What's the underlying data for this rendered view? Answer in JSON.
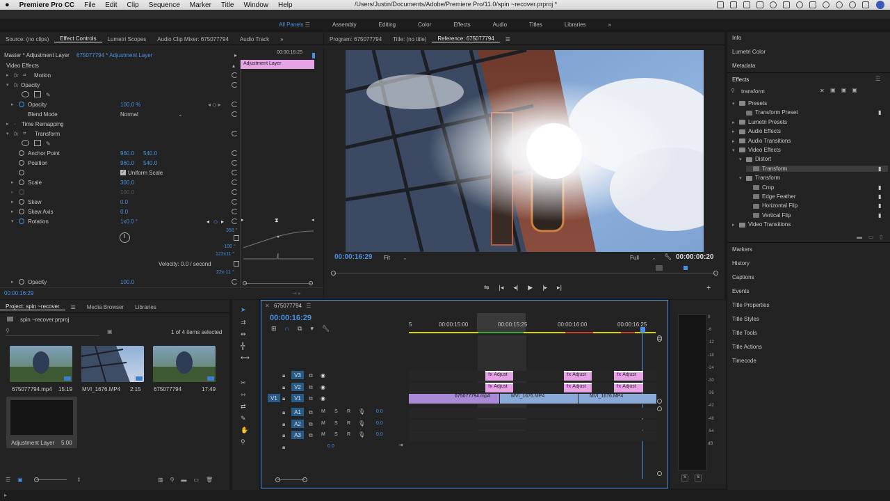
{
  "menubar": {
    "apple": "",
    "app": "Premiere Pro CC",
    "items": [
      "File",
      "Edit",
      "Clip",
      "Sequence",
      "Marker",
      "Title",
      "Window",
      "Help"
    ],
    "path": "/Users/Justin/Documents/Adobe/Premiere Pro/11.0/spin ~recover.prproj *"
  },
  "workspaces": [
    "All Panels",
    "Assembly",
    "Editing",
    "Color",
    "Effects",
    "Audio",
    "Titles",
    "Libraries"
  ],
  "workspace_more": "»",
  "source_panel": {
    "tabs": [
      "Source: (no clips)",
      "Effect Controls",
      "Lumetri Scopes",
      "Audio Clip Mixer: 675077794",
      "Audio Track"
    ],
    "more": "»",
    "master": "Master * Adjustment Layer",
    "clip": "675077794 * Adjustment Layer",
    "mini_time": "00:00:16:25",
    "mini_clip": "Adjustment Layer",
    "video_effects": "Video Effects",
    "motion": "Motion",
    "opacity": "Opacity",
    "opacity_label": "Opacity",
    "opacity_val": "100.0 %",
    "blend_mode": "Blend Mode",
    "blend_val": "Normal",
    "time_remap": "Time Remapping",
    "transform": "Transform",
    "anchor": "Anchor Point",
    "anchor_x": "960.0",
    "anchor_y": "540.0",
    "position": "Position",
    "pos_x": "960.0",
    "pos_y": "540.0",
    "uniform_scale": "Uniform Scale",
    "scale": "Scale",
    "scale_val": "300.0",
    "scale_w": "100.0",
    "skew": "Skew",
    "skew_val": "0.0",
    "skew_axis": "Skew Axis",
    "skew_axis_val": "0.0",
    "rotation": "Rotation",
    "rotation_val": "1x0.0 °",
    "graph_top": "358 °",
    "graph_mid": "-100 °",
    "graph_v1": "122x11 °",
    "velocity": "Velocity: 0.0 / second",
    "graph_v2": "22x-11 °",
    "opacity2": "Opacity",
    "opacity2_val": "100.0",
    "timecode": "00:00:16:29"
  },
  "program": {
    "tabs": [
      "Program: 675077794",
      "Title: (no title)",
      "Reference: 675077794"
    ],
    "timecode": "00:00:16:29",
    "fit": "Fit",
    "full": "Full",
    "duration": "00:00:00:20"
  },
  "right_panel": {
    "top_items": [
      "Info",
      "Lumetri Color",
      "Metadata"
    ],
    "effects_title": "Effects",
    "search": "transform",
    "tree": [
      {
        "label": "Presets",
        "indent": 0
      },
      {
        "label": "Transform Preset",
        "indent": 1
      },
      {
        "label": "Lumetri Presets",
        "indent": 0
      },
      {
        "label": "Audio Effects",
        "indent": 0
      },
      {
        "label": "Audio Transitions",
        "indent": 0
      },
      {
        "label": "Video Effects",
        "indent": 0
      },
      {
        "label": "Distort",
        "indent": 1
      },
      {
        "label": "Transform",
        "indent": 2
      },
      {
        "label": "Transform",
        "indent": 1
      },
      {
        "label": "Crop",
        "indent": 2
      },
      {
        "label": "Edge Feather",
        "indent": 2
      },
      {
        "label": "Horizontal Flip",
        "indent": 2
      },
      {
        "label": "Vertical Flip",
        "indent": 2
      },
      {
        "label": "Video Transitions",
        "indent": 0
      }
    ],
    "bottom_items": [
      "Markers",
      "History",
      "Captions",
      "Events",
      "Title Properties",
      "Title Styles",
      "Title Tools",
      "Title Actions",
      "Timecode"
    ]
  },
  "project": {
    "tabs": [
      "Project: spin ~recover",
      "Media Browser",
      "Libraries"
    ],
    "file": "spin ~recover.prproj",
    "count": "1 of 4 items selected",
    "items": [
      {
        "name": "675077794.mp4",
        "dur": "15:19"
      },
      {
        "name": "MVI_1676.MP4",
        "dur": "2:15"
      },
      {
        "name": "675077794",
        "dur": "17:49"
      },
      {
        "name": "Adjustment Layer",
        "dur": "5:00"
      }
    ]
  },
  "timeline": {
    "seq": "675077794",
    "timecode": "00:00:16:29",
    "ruler": [
      "00:00:15:00",
      "00:00:15:25",
      "00:00:16:00",
      "00:00:16:25"
    ],
    "ruler_left": "5",
    "tracks_v": [
      "V3",
      "V2",
      "V1"
    ],
    "tracks_a": [
      "A1",
      "A2",
      "A3"
    ],
    "src_v": "V1",
    "a_vol": "0.0",
    "master_vol": "0.0",
    "adj": "Adjust",
    "clip1": "675077794.mp4",
    "clip2": "MVI_1676.MP4",
    "clip3": "MVI_1676.MP4",
    "mse": [
      "M",
      "S",
      "R"
    ]
  },
  "meter": {
    "labels": [
      "0",
      "-6",
      "-12",
      "-18",
      "-24",
      "-30",
      "-36",
      "-42",
      "-48",
      "-54",
      "dB"
    ],
    "solo": "S"
  }
}
